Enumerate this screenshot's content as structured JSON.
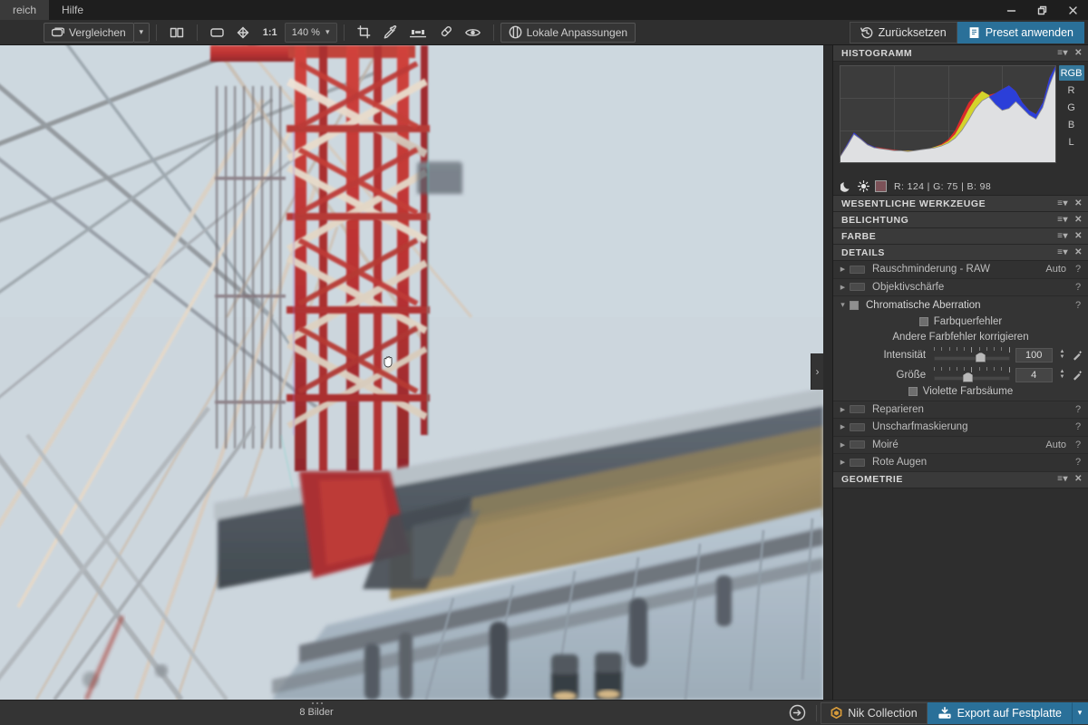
{
  "titlebar": {
    "menus": [
      {
        "label": "reich"
      },
      {
        "label": "Hilfe"
      }
    ],
    "window_controls": [
      {
        "name": "minimize",
        "glyph": "–"
      },
      {
        "name": "restore",
        "glyph": "❐"
      },
      {
        "name": "close",
        "glyph": "✕"
      }
    ]
  },
  "toolbar": {
    "compare_label": "Vergleichen",
    "compare_caret": "▾",
    "ratio_label": "1:1",
    "zoom_value": "140 %",
    "zoom_caret": "▾",
    "local_adjust_label": "Lokale Anpassungen",
    "reset_label": "Zurücksetzen",
    "apply_preset_label": "Preset anwenden",
    "icons": {
      "compare": "compare-icon",
      "split_view": "split-view-icon",
      "fit_view": "fit-to-view-icon",
      "pan": "pan-hand-icon",
      "crop": "crop-icon",
      "eyedropper": "eyedropper-icon",
      "horizon": "horizon-level-icon",
      "clone": "clone-stamp-icon",
      "preview": "preview-eye-icon",
      "local_adjust": "local-adjustments-icon",
      "reset": "reset-clock-icon",
      "apply_preset": "preset-icon"
    }
  },
  "canvas": {
    "collapse_handle": "›",
    "cursor": "open-hand-cursor"
  },
  "panel": {
    "histogram": {
      "title": "HISTOGRAMM",
      "menu_glyph": "≡▾",
      "close_glyph": "✕",
      "channels": [
        {
          "label": "RGB",
          "active": true
        },
        {
          "label": "R",
          "active": false
        },
        {
          "label": "G",
          "active": false
        },
        {
          "label": "B",
          "active": false
        },
        {
          "label": "L",
          "active": false
        }
      ],
      "shadow_icon": "moon-icon",
      "highlight_icon": "sun-icon",
      "swatch_color": "#7c5258",
      "readout": "R:  124  |  G:   75  |  B:   98",
      "readout_values": {
        "r": "124",
        "g": "75",
        "b": "98"
      }
    },
    "sections": [
      {
        "title": "WESENTLICHE WERKZEUGE"
      },
      {
        "title": "BELICHTUNG"
      },
      {
        "title": "FARBE"
      },
      {
        "title": "DETAILS"
      },
      {
        "title": "GEOMETRIE"
      }
    ],
    "details_tools_top": [
      {
        "label": "Rauschminderung - RAW",
        "auto": "Auto",
        "help": "?",
        "toggle": true
      },
      {
        "label": "Objektivschärfe",
        "auto": "",
        "help": "?",
        "toggle": true
      }
    ],
    "chromatic_aberration": {
      "title": "Chromatische Aberration",
      "help": "?",
      "expand_glyph": "▾",
      "checkbox_lateral_label": "Farbquerfehler",
      "other_errors_label": "Andere Farbfehler korrigieren",
      "sliders": [
        {
          "label": "Intensität",
          "value": "100",
          "percent": 52
        },
        {
          "label": "Größe",
          "value": "4",
          "percent": 38
        }
      ],
      "checkbox_purple_label": "Violette Farbsäume"
    },
    "details_tools_bottom": [
      {
        "label": "Reparieren",
        "auto": "",
        "help": "?",
        "toggle": true
      },
      {
        "label": "Unscharfmaskierung",
        "auto": "",
        "help": "?",
        "toggle": true
      },
      {
        "label": "Moiré",
        "auto": "Auto",
        "help": "?",
        "toggle": true
      },
      {
        "label": "Rote Augen",
        "auto": "",
        "help": "?",
        "toggle": true
      }
    ]
  },
  "statusbar": {
    "image_count": "8 Bilder",
    "export_to_app_icon": "export-to-application-icon",
    "nik_collection_label": "Nik Collection",
    "export_label": "Export auf Festplatte",
    "export_caret": "▾"
  },
  "colors": {
    "accent": "#2a7099",
    "panel_bg": "#2e2e2e",
    "toolbar_bg": "#2f2f2f",
    "titlebar_bg": "#1e1e1e"
  },
  "chart_data": {
    "type": "area",
    "title": "HISTOGRAMM",
    "xlabel": "",
    "ylabel": "",
    "grid": true,
    "legend_position": "right",
    "legend": [
      "RGB",
      "R",
      "G",
      "B",
      "L"
    ],
    "x": [
      0,
      8,
      16,
      24,
      32,
      40,
      48,
      56,
      64,
      72,
      80,
      88,
      96,
      104,
      112,
      120,
      128,
      136,
      144,
      152,
      160,
      168,
      176,
      184,
      192,
      200,
      208,
      216,
      224,
      232,
      240,
      248,
      255
    ],
    "series": [
      {
        "name": "R",
        "values": [
          6,
          18,
          30,
          25,
          19,
          16,
          15,
          14,
          13,
          12,
          12,
          12,
          13,
          14,
          16,
          19,
          24,
          33,
          48,
          62,
          70,
          72,
          68,
          60,
          56,
          58,
          66,
          58,
          50,
          46,
          58,
          82,
          96
        ]
      },
      {
        "name": "G",
        "values": [
          6,
          17,
          29,
          24,
          18,
          15,
          14,
          13,
          12,
          12,
          12,
          12,
          13,
          14,
          16,
          18,
          22,
          29,
          41,
          55,
          66,
          74,
          70,
          60,
          54,
          56,
          63,
          56,
          49,
          45,
          57,
          80,
          97
        ]
      },
      {
        "name": "B",
        "values": [
          7,
          19,
          31,
          25,
          19,
          16,
          14,
          13,
          12,
          12,
          11,
          12,
          13,
          14,
          15,
          17,
          20,
          25,
          33,
          44,
          56,
          64,
          68,
          72,
          76,
          80,
          74,
          62,
          54,
          50,
          62,
          88,
          100
        ]
      },
      {
        "name": "L",
        "values": [
          6,
          18,
          30,
          25,
          18,
          15,
          14,
          13,
          12,
          12,
          12,
          12,
          13,
          14,
          16,
          18,
          22,
          29,
          40,
          52,
          62,
          68,
          66,
          58,
          54,
          56,
          64,
          57,
          50,
          46,
          58,
          83,
          97
        ]
      }
    ],
    "ylim": [
      0,
      100
    ],
    "xlim": [
      0,
      255
    ]
  }
}
